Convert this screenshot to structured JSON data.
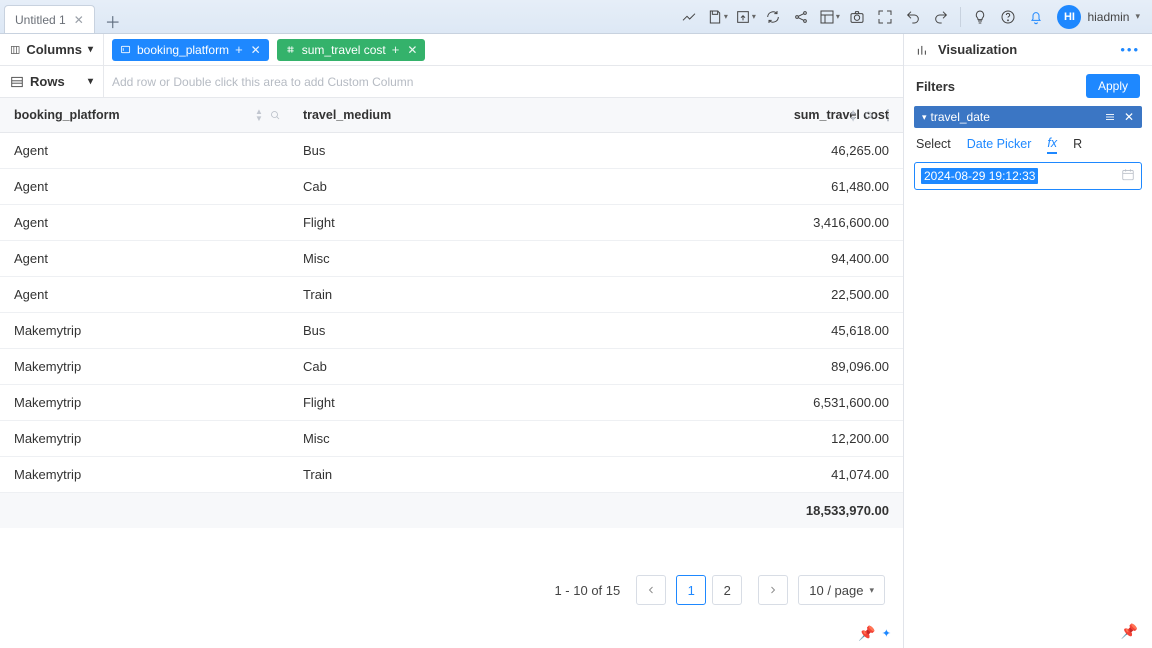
{
  "tabs": {
    "active": "Untitled 1"
  },
  "toolbar_icons": [
    "chart-line-icon",
    "save-icon",
    "export-icon",
    "refresh-icon",
    "share-icon",
    "layout-icon",
    "camera-icon",
    "expand-icon",
    "undo-icon",
    "redo-icon",
    "idea-icon",
    "help-icon",
    "notifications-icon"
  ],
  "user": {
    "initials": "HI",
    "name": "hiadmin"
  },
  "shelf": {
    "columns_label": "Columns",
    "rows_label": "Rows",
    "rows_placeholder": "Add row or Double click this area to add Custom Column",
    "pills": [
      {
        "color": "blue",
        "icon": "text",
        "label": "booking_platform"
      },
      {
        "color": "green",
        "icon": "number",
        "label": "sum_travel cost"
      }
    ]
  },
  "table": {
    "headers": {
      "col1": "booking_platform",
      "col2": "travel_medium",
      "col3": "sum_travel cost"
    },
    "rows": [
      {
        "bp": "Agent",
        "tm": "Bus",
        "cost": "46,265.00"
      },
      {
        "bp": "Agent",
        "tm": "Cab",
        "cost": "61,480.00"
      },
      {
        "bp": "Agent",
        "tm": "Flight",
        "cost": "3,416,600.00"
      },
      {
        "bp": "Agent",
        "tm": "Misc",
        "cost": "94,400.00"
      },
      {
        "bp": "Agent",
        "tm": "Train",
        "cost": "22,500.00"
      },
      {
        "bp": "Makemytrip",
        "tm": "Bus",
        "cost": "45,618.00"
      },
      {
        "bp": "Makemytrip",
        "tm": "Cab",
        "cost": "89,096.00"
      },
      {
        "bp": "Makemytrip",
        "tm": "Flight",
        "cost": "6,531,600.00"
      },
      {
        "bp": "Makemytrip",
        "tm": "Misc",
        "cost": "12,200.00"
      },
      {
        "bp": "Makemytrip",
        "tm": "Train",
        "cost": "41,074.00"
      }
    ],
    "total": "18,533,970.00"
  },
  "pagination": {
    "range": "1 - 10 of 15",
    "pages": [
      "1",
      "2"
    ],
    "active": "1",
    "size_label": "10 / page"
  },
  "right": {
    "viz_label": "Visualization",
    "filters_label": "Filters",
    "apply_label": "Apply",
    "filter_field": "travel_date",
    "filter_tabs": {
      "select": "Select",
      "date_picker": "Date Picker",
      "fx": "fx",
      "r": "R"
    },
    "date_value": "2024-08-29 19:12:33"
  }
}
